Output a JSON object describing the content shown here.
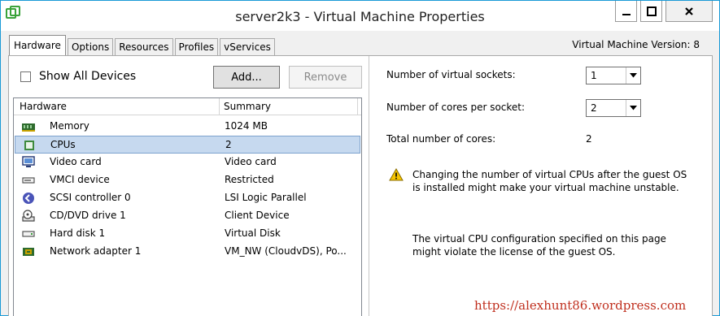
{
  "window": {
    "title": "server2k3 - Virtual Machine Properties",
    "icons": {
      "app": "vm-app-icon",
      "minimize": "minimize-icon",
      "maximize": "maximize-icon",
      "close": "close-icon"
    }
  },
  "tabs": [
    {
      "label": "Hardware",
      "active": true
    },
    {
      "label": "Options",
      "active": false
    },
    {
      "label": "Resources",
      "active": false
    },
    {
      "label": "Profiles",
      "active": false
    },
    {
      "label": "vServices",
      "active": false
    }
  ],
  "vm_version": "Virtual Machine Version: 8",
  "left": {
    "show_all_devices_label": "Show All Devices",
    "show_all_devices_checked": false,
    "add_button": "Add...",
    "remove_button": "Remove",
    "table": {
      "headers": [
        "Hardware",
        "Summary"
      ],
      "rows": [
        {
          "name": "Memory",
          "summary": "1024 MB",
          "icon": "memory-icon",
          "selected": false
        },
        {
          "name": "CPUs",
          "summary": "2",
          "icon": "cpu-icon",
          "selected": true
        },
        {
          "name": "Video card",
          "summary": "Video card",
          "icon": "monitor-icon",
          "selected": false
        },
        {
          "name": "VMCI device",
          "summary": "Restricted",
          "icon": "device-icon",
          "selected": false
        },
        {
          "name": "SCSI controller 0",
          "summary": "LSI Logic Parallel",
          "icon": "scsi-icon",
          "selected": false
        },
        {
          "name": "CD/DVD drive 1",
          "summary": "Client Device",
          "icon": "cd-drive-icon",
          "selected": false
        },
        {
          "name": "Hard disk 1",
          "summary": "Virtual Disk",
          "icon": "hard-disk-icon",
          "selected": false
        },
        {
          "name": "Network adapter 1",
          "summary": "VM_NW (CloudvDS), Po...",
          "icon": "network-adapter-icon",
          "selected": false
        }
      ]
    }
  },
  "right": {
    "sockets_label": "Number of virtual sockets:",
    "sockets_value": "1",
    "cores_label": "Number of cores per socket:",
    "cores_value": "2",
    "total_label": "Total number of cores:",
    "total_value": "2",
    "warning_text": "Changing the number of virtual CPUs after the guest OS is installed might make your virtual machine unstable.",
    "license_text": "The virtual CPU configuration specified on this page might violate the license of the guest OS."
  },
  "watermark": "https://alexhunt86.wordpress.com",
  "colors": {
    "accent_border": "#1a9ad6",
    "selected_row": "#c6d9ef",
    "watermark": "#c0301f"
  }
}
